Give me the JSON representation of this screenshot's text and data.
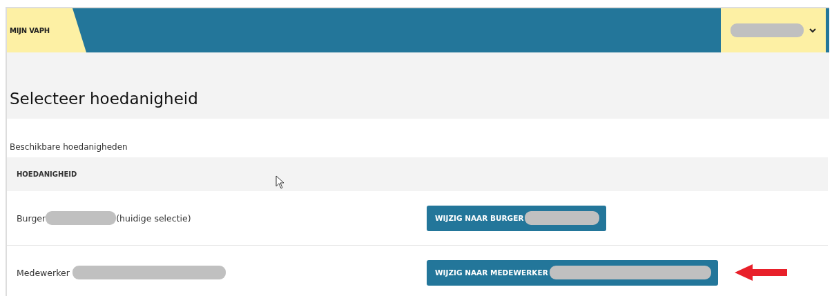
{
  "header": {
    "logo": "MIJN VAPH",
    "user_menu": {
      "redacted": true
    }
  },
  "title": "Selecteer hoedanigheid",
  "subtitle": "Beschikbare hoedanigheden",
  "table": {
    "columns": [
      "HOEDANIGHEID"
    ],
    "rows": [
      {
        "label": "Burger",
        "label_redacted": true,
        "note": "(huidige selectie)",
        "button": "WIJZIG NAAR BURGER",
        "button_redacted": true
      },
      {
        "label": "Medewerker",
        "label_redacted": true,
        "button": "WIJZIG NAAR MEDEWERKER",
        "button_redacted": true,
        "annotated": true
      }
    ]
  }
}
